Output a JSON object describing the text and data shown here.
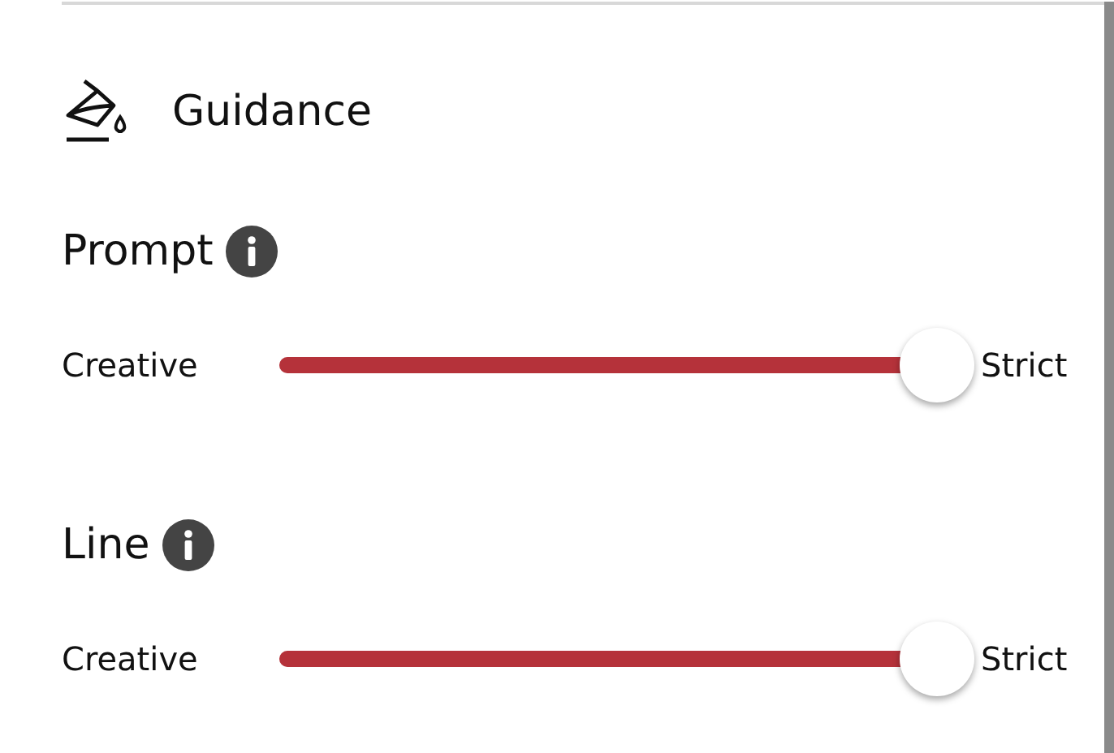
{
  "section": {
    "title": "Guidance"
  },
  "controls": [
    {
      "label": "Prompt",
      "min_label": "Creative",
      "max_label": "Strict",
      "level": 1.0
    },
    {
      "label": "Line",
      "min_label": "Creative",
      "max_label": "Strict",
      "level": 1.0
    }
  ]
}
